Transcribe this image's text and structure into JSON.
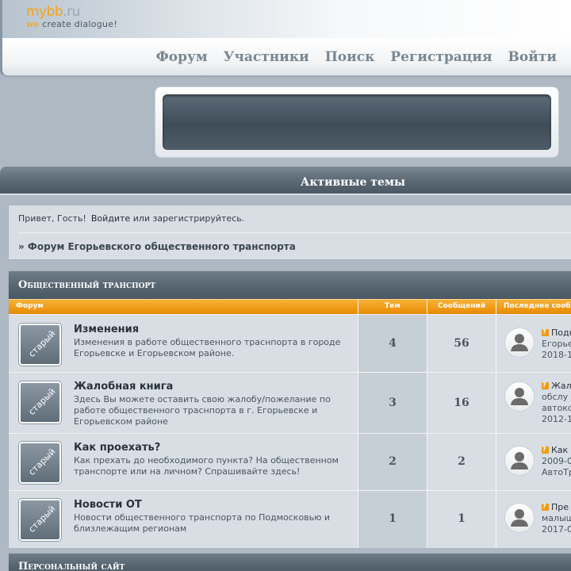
{
  "logo": {
    "brand_main": "mybb",
    "brand_dot": ".",
    "brand_tld": "ru",
    "tagline_we": "we",
    "tagline_rest": " create dialogue!"
  },
  "nav": {
    "items": [
      {
        "label": "Форум"
      },
      {
        "label": "Участники"
      },
      {
        "label": "Поиск"
      },
      {
        "label": "Регистрация"
      },
      {
        "label": "Войти"
      }
    ]
  },
  "active_topics": {
    "label": "Активные темы"
  },
  "welcome": {
    "greeting": "Привет, Гость!",
    "login_link": "Войдите",
    "or": " или ",
    "register_link": "зарегистрируйтесь."
  },
  "breadcrumb": {
    "text": "» Форум Егорьевского общественного транспорта"
  },
  "category": {
    "title": "Общественный транспорт",
    "columns": {
      "forum": "Форум",
      "topics": "Тем",
      "posts": "Сообщений",
      "last_post": "Последнее сообщение"
    },
    "forums": [
      {
        "icon_label": "старый",
        "name": "Изменения",
        "description": "Изменения в работе общественного траснпорта в городе Егорьевске и Егорьевском районе.",
        "topics": "4",
        "posts": "56",
        "last_line1": "Подк",
        "last_line2": "Егорье",
        "last_line3": "2018-1"
      },
      {
        "icon_label": "старый",
        "name": "Жалобная книга",
        "description": "Здесь Вы можете оставить свою жалобу/пожелание по работе общественного траснпорта в г. Егорьевске и Егорьевском районе",
        "topics": "3",
        "posts": "16",
        "last_line1": "Жал",
        "last_line2": "обслу",
        "last_line3": "автоко",
        "last_line4": "2012-1"
      },
      {
        "icon_label": "старый",
        "name": "Как проехать?",
        "description": "Как прехать до необходимого пункта? На общественном транспорте или на личном? Спрашивайте здесь!",
        "topics": "2",
        "posts": "2",
        "last_line1": "Как ,",
        "last_line2": "2009-0",
        "last_line3": "АвтоТр"
      },
      {
        "icon_label": "старый",
        "name": "Новости ОТ",
        "description": "Новости общественного транспорта по Подмосковью и близлежащим регионам",
        "topics": "1",
        "posts": "1",
        "last_line1": "Пре",
        "last_line2": "малыш",
        "last_line3": "2017-0"
      }
    ]
  },
  "category2": {
    "title": "Персональный сайт"
  },
  "colors": {
    "accent_orange": "#f09a14",
    "header_slate": "#55636f",
    "panel": "#d8dee4"
  }
}
